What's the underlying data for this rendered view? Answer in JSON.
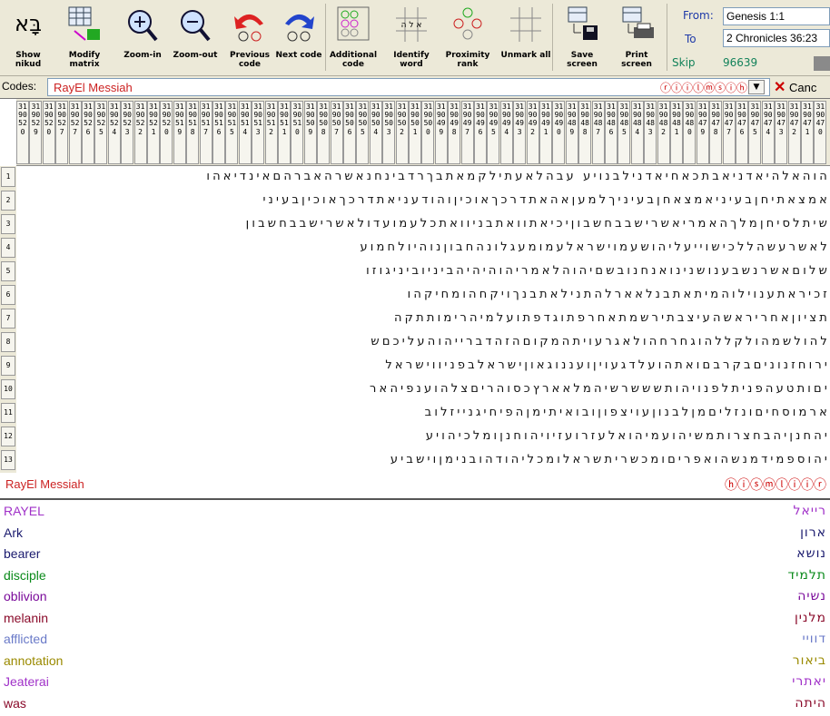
{
  "toolbar": {
    "buttons": [
      {
        "id": "show-nikud",
        "label": "Show nikud",
        "icon": "nikud-hebrew-icon",
        "glyph": "בָּא"
      },
      {
        "id": "modify-matrix",
        "label": "Modify matrix",
        "icon": "matrix-grid-icon"
      },
      {
        "id": "zoom-in",
        "label": "Zoom-in",
        "icon": "zoom-in-icon"
      },
      {
        "id": "zoom-out",
        "label": "Zoom-out",
        "icon": "zoom-out-icon"
      },
      {
        "id": "previous-code",
        "label": "Previous code",
        "icon": "previous-arrow-icon"
      },
      {
        "id": "next-code",
        "label": "Next code",
        "icon": "next-arrow-icon"
      },
      {
        "id": "additional-code",
        "label": "Additional code",
        "icon": "additional-code-icon"
      },
      {
        "id": "identify-word",
        "label": "Identify word",
        "icon": "identify-word-icon"
      },
      {
        "id": "proximity-rank",
        "label": "Proximity rank",
        "icon": "proximity-rank-icon"
      },
      {
        "id": "unmark-all",
        "label": "Unmark all",
        "icon": "unmark-all-icon"
      },
      {
        "id": "save-screen",
        "label": "Save screen",
        "icon": "floppy-disk-icon"
      },
      {
        "id": "print-screen",
        "label": "Print screen",
        "icon": "printer-icon"
      }
    ],
    "range": {
      "from_label": "From:",
      "from_value": "Genesis 1:1",
      "to_label": "To",
      "to_value": "2 Chronicles 36:23"
    },
    "skip_label": "Skip",
    "skip_value": "96639"
  },
  "codes": {
    "label": "Codes:",
    "value": "RayEl Messiah",
    "hebrew": "ⓡⓘⓘⓛⓜⓢⓘⓗ",
    "cancel_label": "Canc"
  },
  "grid": {
    "column_headers": [
      "3190520",
      "3190529",
      "3190520",
      "3190527",
      "3190527",
      "3190526",
      "3190525",
      "3190524",
      "3190523",
      "3190522",
      "3190521",
      "3190520",
      "3190519",
      "3190518",
      "3190517",
      "3190516",
      "3190515",
      "3190514",
      "3190513",
      "3190512",
      "3190511",
      "3190510",
      "3190509",
      "3190508",
      "3190507",
      "3190506",
      "3190505",
      "3190504",
      "3190503",
      "3190502",
      "3190501",
      "3190500",
      "3190499",
      "3190498",
      "3190497",
      "3190496",
      "3190495",
      "3190494",
      "3190493",
      "3190492",
      "3190491",
      "3190490",
      "3190489",
      "3190488",
      "3190487",
      "3190486",
      "3190485",
      "3190484",
      "3190483",
      "3190482",
      "3190481",
      "3190480",
      "3190479",
      "3190478",
      "3190477",
      "3190476",
      "3190475",
      "3190474",
      "3190473",
      "3190472",
      "3190471",
      "3190470"
    ],
    "row_numbers": [
      "1",
      "2",
      "3",
      "4",
      "5",
      "6",
      "7",
      "8",
      "9",
      "10",
      "11",
      "12",
      "13"
    ],
    "rows": [
      "הוהאלהיאדניאבתכאחיאדנילבנויע עבהלאעתילקמאתבךרדבינחנאשרהאברהםאינדיאהו",
      "אמצאתיחןבעיניאמצאחןבעיניךלמעןאהאתדרכךאוכיןוהודעניאתדרכךאוכיןבעיני",
      "שיתלסיחןמלךהאמריאשרישבבחשבוןיכיאתוואתבניוואתכלעמועדולאשרישבבחשבון",
      "לאשרעשהללכישוייעליהושעמוישראלעמומעגלונהחבוןנוהיולחמוע",
      "שלוםאשרנשבענושנינואנחנובשםיהוהלאמריהוהיהיהביניוביניגוזו",
      "זכיראתענוילוהמיתאתבנלאארלהתנילאתבנךויקחהומחיקהו",
      "תציוןאחריראשהעיצבתירשמתאחרפתוגדפתועלמיהרימותתקה",
      "להולשמהולקללהוגחרחהולאגרעויתהמקוםהזהדברייהוהעליכםש",
      "ירוחזנוניםבקרבםואתהועלדגעויןועננוגאוןישראלבפניווישראל",
      "יםותטעהפניתלפנויהותשששרשיהמלאארץכסוהריםצלהוענפיהאר",
      "ארמוסחיםונזליםמןלבנוןעויצפוןובואיתימןהפיחיגנייזלוב",
      "יהחנןיהבחצרותמשיהועמיהואלעזרועזיויהוחנןומלכיהויע",
      "יהוספמידמנשהואפריםומכשריתשראלומכליהודהובנימןוישביע"
    ],
    "legend_name": "RayEl Messiah",
    "legend_hebrew": "ⓗⓘⓢⓜⓛⓘⓘⓡ"
  },
  "terms": [
    {
      "name": "RAYEL",
      "color": "#a031c8",
      "hebrew": "רייאל"
    },
    {
      "name": "Ark",
      "color": "#1a1a6e",
      "hebrew": "ארון"
    },
    {
      "name": "bearer",
      "color": "#1a1a6e",
      "hebrew": "נושא"
    },
    {
      "name": "disciple",
      "color": "#0a8a1a",
      "hebrew": "תלמיד"
    },
    {
      "name": "oblivion",
      "color": "#7a0a9a",
      "hebrew": "נשיה"
    },
    {
      "name": "melanin",
      "color": "#8a0a2a",
      "hebrew": "מלנין"
    },
    {
      "name": "afflicted",
      "color": "#6a7ac8",
      "hebrew": "דוויי"
    },
    {
      "name": "annotation",
      "color": "#9a8a00",
      "hebrew": "ביאור"
    },
    {
      "name": "Jeaterai",
      "color": "#a031c8",
      "hebrew": "יאתרי"
    },
    {
      "name": "was",
      "color": "#8a0a2a",
      "hebrew": "היתה"
    }
  ],
  "colors": {
    "chrome": "#ece9d8",
    "code_red": "#cc2222",
    "skip_green": "#13825a",
    "range_blue": "#1f3aa8"
  }
}
